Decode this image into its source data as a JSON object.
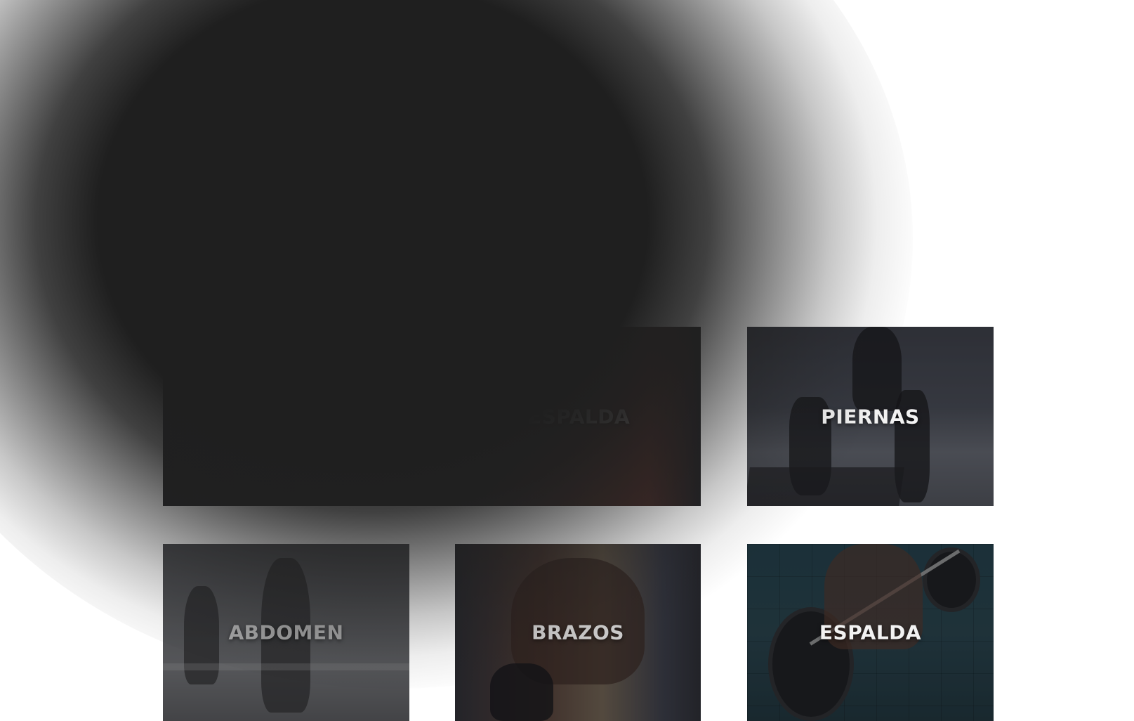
{
  "categories": {
    "wide": {
      "label": "ESPALDA"
    },
    "piernas": {
      "label": "PIERNAS"
    },
    "abdomen": {
      "label": "ABDOMEN"
    },
    "brazos": {
      "label": "BRAZOS"
    },
    "espalda": {
      "label": "ESPALDA"
    }
  },
  "colors": {
    "overlay": "#1f1f1f",
    "label_text": "#f2f2f2",
    "background": "#ffffff"
  },
  "icons": [
    "dumbbell-photo",
    "barbell-photo"
  ]
}
